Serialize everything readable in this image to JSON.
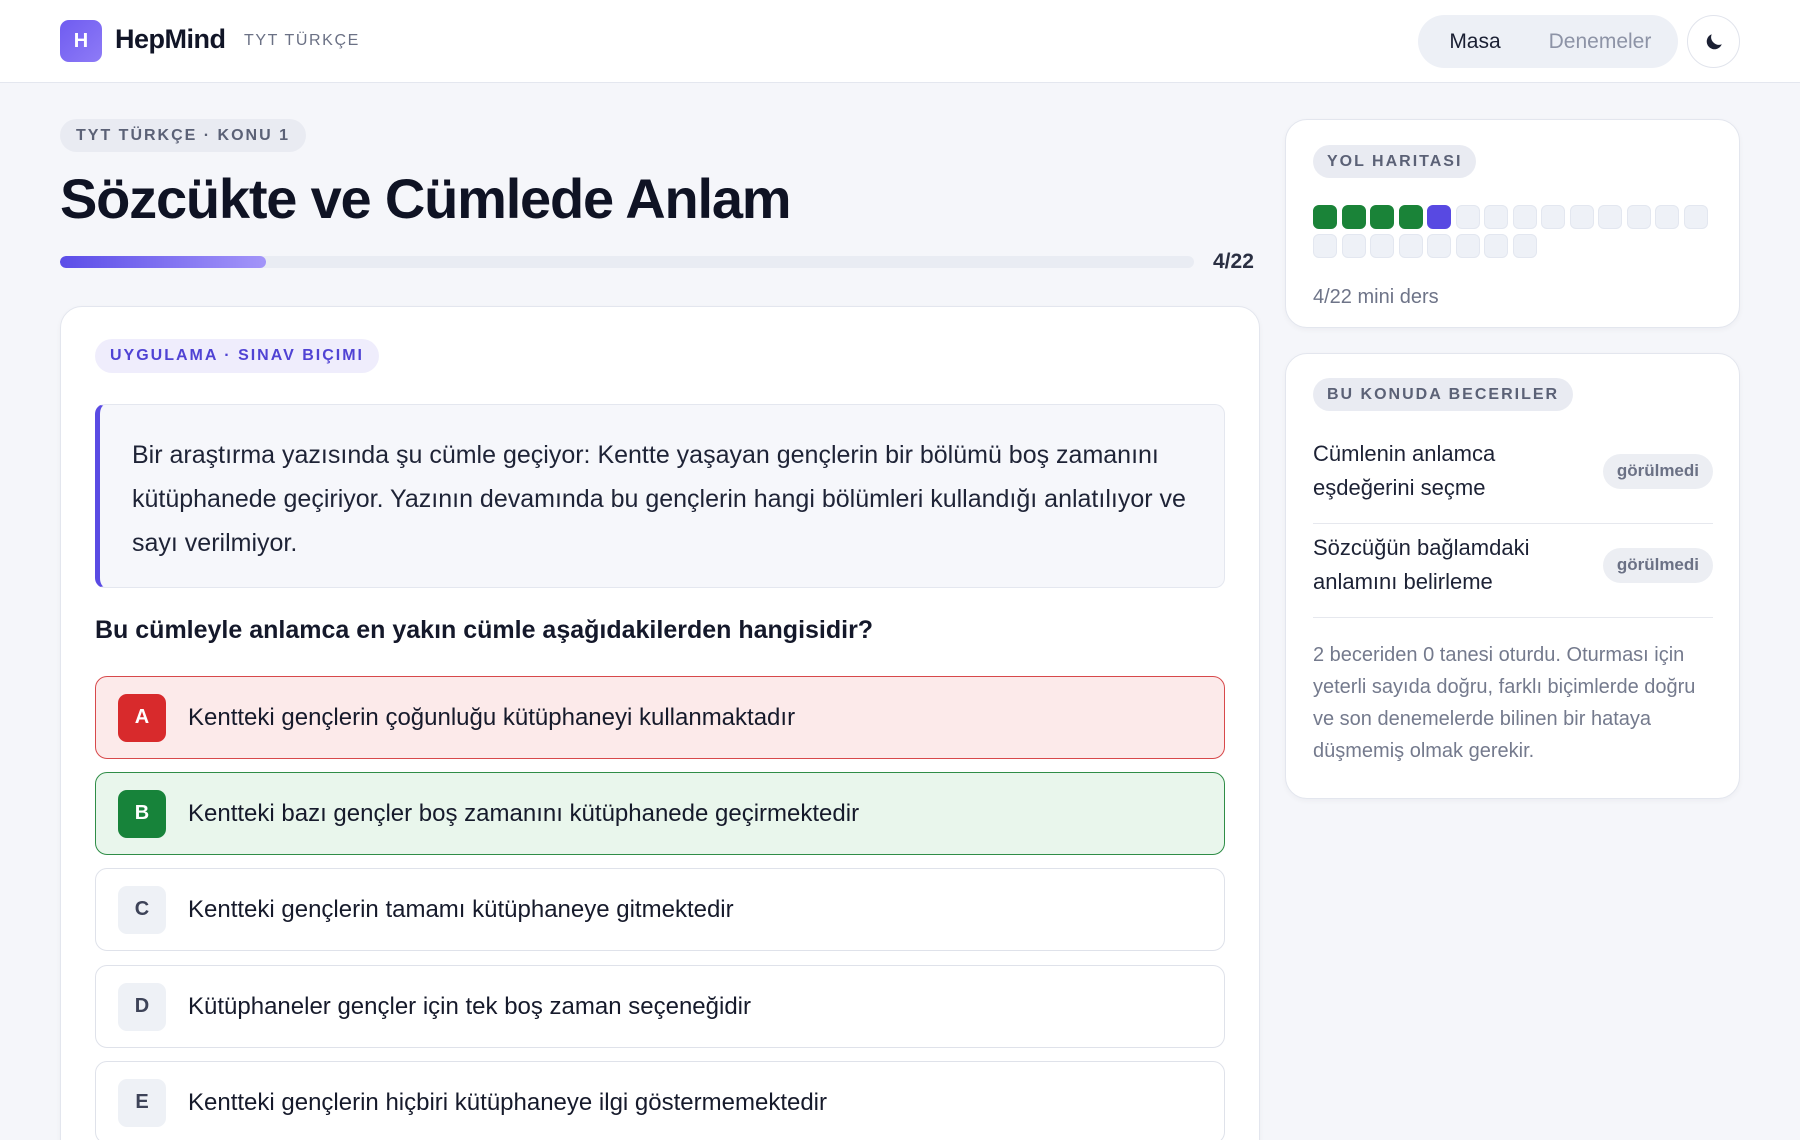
{
  "header": {
    "logo_letter": "H",
    "app_name": "HepMind",
    "subject": "TYT TÜRKÇE",
    "tabs": [
      {
        "label": "Masa",
        "active": true
      },
      {
        "label": "Denemeler",
        "active": false
      }
    ],
    "theme_icon": "moon-icon"
  },
  "lesson": {
    "breadcrumb": "TYT TÜRKÇE · KONU 1",
    "title": "Sözcükte ve Cümlede Anlam",
    "progress_text": "4/22",
    "progress_fraction": 0.1818
  },
  "exercise": {
    "tag": "UYGULAMA · SINAV BIÇIMI",
    "passage": "Bir araştırma yazısında şu cümle geçiyor: Kentte yaşayan gençlerin bir bölümü boş zamanını kütüphanede geçiriyor. Yazının devamında bu gençlerin hangi bölümleri kullandığı anlatılıyor ve sayı verilmiyor.",
    "question": "Bu cümleyle anlamca en yakın cümle aşağıdakilerden hangisidir?",
    "options": [
      {
        "letter": "A",
        "text": "Kentteki gençlerin çoğunluğu kütüphaneyi kullanmaktadır",
        "state": "wrong"
      },
      {
        "letter": "B",
        "text": "Kentteki bazı gençler boş zamanını kütüphanede geçirmektedir",
        "state": "correct"
      },
      {
        "letter": "C",
        "text": "Kentteki gençlerin tamamı kütüphaneye gitmektedir",
        "state": "neutral"
      },
      {
        "letter": "D",
        "text": "Kütüphaneler gençler için tek boş zaman seçeneğidir",
        "state": "neutral"
      },
      {
        "letter": "E",
        "text": "Kentteki gençlerin hiçbiri kütüphaneye ilgi göstermemektedir",
        "state": "neutral"
      }
    ]
  },
  "roadmap": {
    "tag": "YOL HARITASI",
    "total": 22,
    "completed": 4,
    "current_index": 5,
    "caption": "4/22 mini ders",
    "colors": {
      "done": "#1a8338",
      "current": "#5849e2",
      "pending": "#eef1f7"
    }
  },
  "skills": {
    "tag": "BU KONUDA BECERILER",
    "items": [
      {
        "name": "Cümlenin anlamca eşdeğerini seçme",
        "status": "görülmedi"
      },
      {
        "name": "Sözcüğün bağlamdaki anlamını belirleme",
        "status": "görülmedi"
      }
    ],
    "note": "2 beceriden 0 tanesi oturdu. Oturması için yeterli sayıda doğru, farklı biçimlerde doğru ve son denemelerde bilinen bir hataya düşmemiş olmak gerekir."
  }
}
